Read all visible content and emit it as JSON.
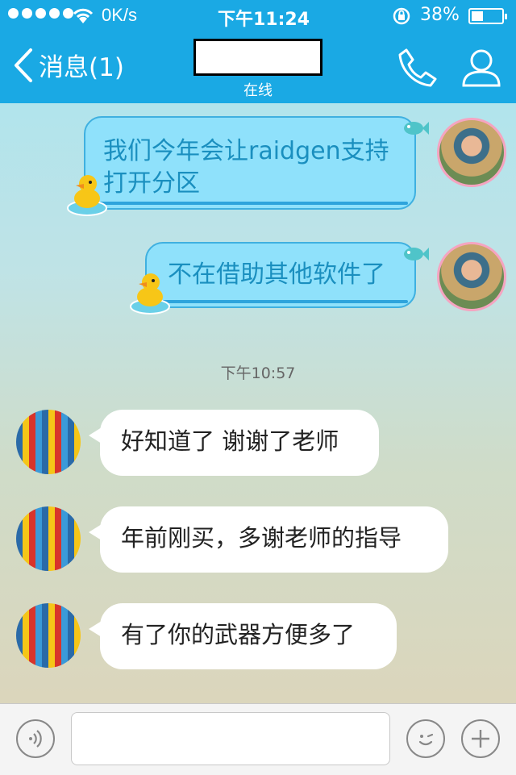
{
  "status_bar": {
    "network_speed": "0K/s",
    "time": "下午11:24",
    "battery_percent": "38%",
    "battery_level": 0.38
  },
  "nav": {
    "back_label": "消息(1)",
    "contact_status": "在线"
  },
  "messages": [
    {
      "direction": "out",
      "text": "我们今年会让raidgen支持打开分区"
    },
    {
      "direction": "out",
      "text": "不在借助其他软件了"
    },
    {
      "type": "timestamp",
      "text": "下午10:57"
    },
    {
      "direction": "in",
      "text": "好知道了 谢谢了老师"
    },
    {
      "direction": "in",
      "text": "年前刚买，多谢老师的指导"
    },
    {
      "direction": "in",
      "text": "有了你的武器方便多了"
    }
  ],
  "input": {
    "value": "",
    "placeholder": ""
  },
  "icons": {
    "back": "chevron-left-icon",
    "phone": "phone-icon",
    "profile": "person-icon",
    "voice": "voice-icon",
    "emoji": "emoji-icon",
    "more": "plus-icon"
  },
  "colors": {
    "header": "#1aa9e4",
    "outgoing_bubble": "#8fe1fb",
    "outgoing_text": "#1a8fbf",
    "incoming_bubble": "#ffffff"
  }
}
